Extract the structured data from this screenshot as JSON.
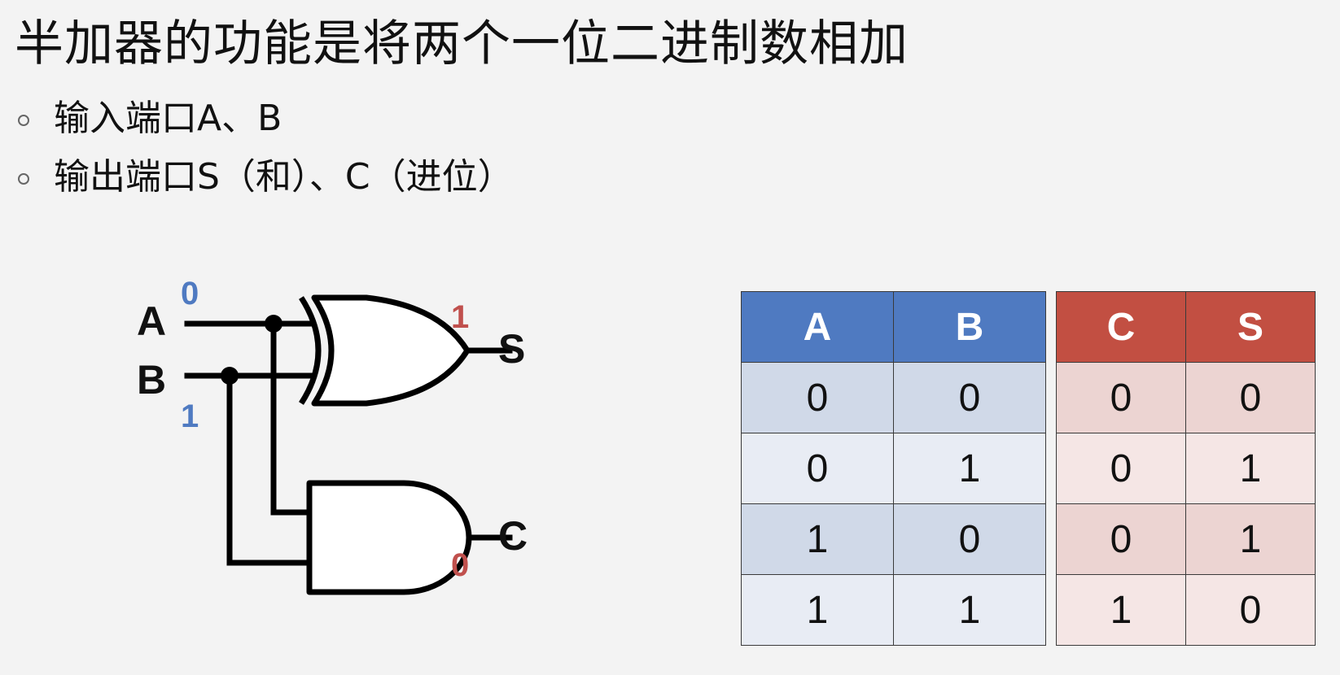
{
  "slide": {
    "title": "半加器的功能是将两个一位二进制数相加",
    "bullets": [
      "输入端口A、B",
      "输出端口S（和）、C（进位）"
    ]
  },
  "circuit": {
    "gates": [
      "xor-gate",
      "and-gate"
    ],
    "labels": {
      "a": "A",
      "b": "B",
      "s": "S",
      "c": "C"
    },
    "values": {
      "a": "0",
      "b": "1",
      "s": "1",
      "c": "0"
    },
    "colors": {
      "input_value": "#4f7ac1",
      "output_value": "#c0504d",
      "wire": "#000000"
    }
  },
  "truth_table": {
    "input_headers": [
      "A",
      "B"
    ],
    "output_headers": [
      "C",
      "S"
    ],
    "rows": [
      {
        "a": "0",
        "b": "0",
        "c": "0",
        "s": "0"
      },
      {
        "a": "0",
        "b": "1",
        "c": "0",
        "s": "1"
      },
      {
        "a": "1",
        "b": "0",
        "c": "0",
        "s": "1"
      },
      {
        "a": "1",
        "b": "1",
        "c": "1",
        "s": "0"
      }
    ],
    "colors": {
      "input_header": "#4f7ac1",
      "output_header": "#c24f42",
      "input_row_dark": "#d0d9e8",
      "input_row_light": "#e8ecf4",
      "output_row_dark": "#ecd4d2",
      "output_row_light": "#f5e6e5"
    }
  }
}
